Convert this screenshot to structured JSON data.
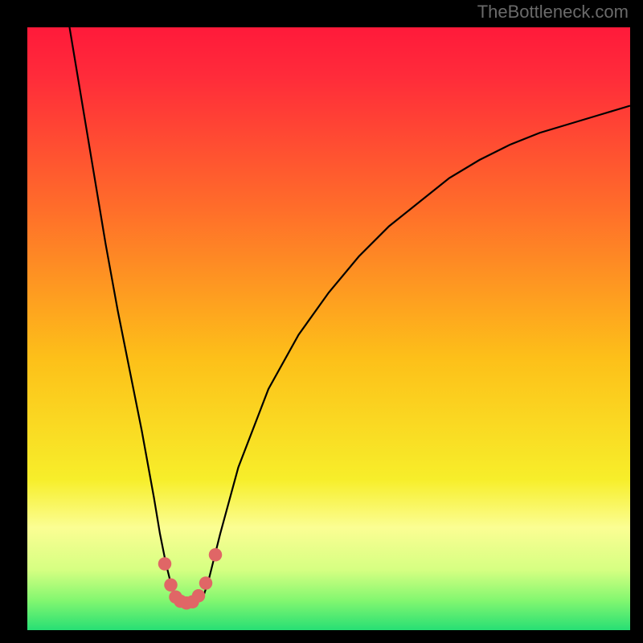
{
  "watermark": "TheBottleneck.com",
  "chart_data": {
    "type": "line",
    "title": "",
    "xlabel": "",
    "ylabel": "",
    "xlim": [
      0,
      100
    ],
    "ylim": [
      0,
      100
    ],
    "background_gradient": [
      {
        "offset": 0.0,
        "color": "#ff1a3a"
      },
      {
        "offset": 0.08,
        "color": "#ff2b3a"
      },
      {
        "offset": 0.3,
        "color": "#ff6d2a"
      },
      {
        "offset": 0.55,
        "color": "#fdc019"
      },
      {
        "offset": 0.75,
        "color": "#f7ee2a"
      },
      {
        "offset": 0.83,
        "color": "#fbfe93"
      },
      {
        "offset": 0.9,
        "color": "#d6ff82"
      },
      {
        "offset": 0.95,
        "color": "#84f770"
      },
      {
        "offset": 1.0,
        "color": "#27df74"
      }
    ],
    "series": [
      {
        "name": "bottleneck-curve",
        "color": "#000000",
        "x": [
          7.0,
          9.0,
          11.0,
          13.0,
          15.0,
          17.0,
          19.0,
          21.0,
          22.0,
          23.0,
          24.0,
          25.0,
          26.0,
          27.0,
          29.0,
          30.0,
          32.0,
          35.0,
          40.0,
          45.0,
          50.0,
          55.0,
          60.0,
          65.0,
          70.0,
          75.0,
          80.0,
          85.0,
          90.0,
          95.0,
          100.0
        ],
        "y": [
          100.0,
          88.0,
          76.0,
          64.0,
          53.0,
          43.0,
          33.0,
          22.0,
          16.0,
          11.0,
          7.0,
          5.0,
          4.5,
          4.5,
          5.0,
          8.0,
          16.0,
          27.0,
          40.0,
          49.0,
          56.0,
          62.0,
          67.0,
          71.0,
          75.0,
          78.0,
          80.5,
          82.5,
          84.0,
          85.5,
          87.0
        ]
      }
    ],
    "markers": {
      "name": "highlight-points",
      "color": "#e06666",
      "radius_data": 1.1,
      "points": [
        {
          "x": 22.8,
          "y": 11.0
        },
        {
          "x": 23.8,
          "y": 7.5
        },
        {
          "x": 24.6,
          "y": 5.5
        },
        {
          "x": 25.4,
          "y": 4.8
        },
        {
          "x": 26.4,
          "y": 4.5
        },
        {
          "x": 27.4,
          "y": 4.7
        },
        {
          "x": 28.4,
          "y": 5.7
        },
        {
          "x": 29.6,
          "y": 7.8
        },
        {
          "x": 31.2,
          "y": 12.5
        }
      ]
    }
  }
}
